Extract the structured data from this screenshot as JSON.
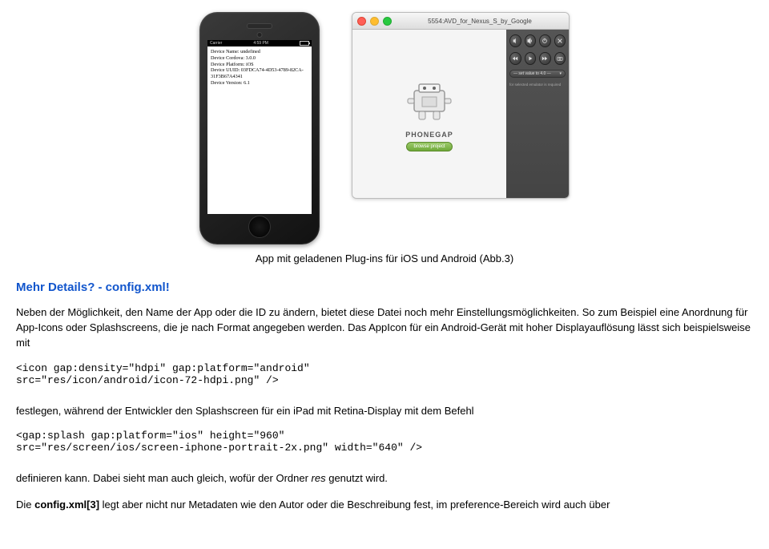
{
  "figures": {
    "phone": {
      "status_carrier": "Carrier",
      "status_signal": "≈",
      "status_time": "4:59 PM",
      "device_lines": [
        "Device Name: undefined",
        "Device Cordova: 3.0.0",
        "Device Platform: iOS",
        "Device UUID: 03FDCA74-4D53-4789-82CA-31F3B67A4341",
        "Device Version: 6.1"
      ]
    },
    "emulator": {
      "window_title": "5554:AVD_for_Nexus_S_by_Google",
      "label": "PHONEGAP",
      "browse_btn": "browse project",
      "side_combo": "— set value to 4.0 —",
      "side_note": "for selected emulator is required"
    }
  },
  "caption": "App mit geladenen Plug-ins für iOS und Android (Abb.3)",
  "heading": "Mehr Details? - config.xml!",
  "para1": "Neben der Möglichkeit, den Name der App oder die ID zu ändern, bietet diese Datei noch mehr Einstellungsmöglichkeiten. So zum Beispiel eine Anordnung für App-Icons oder Splashscreens, die je nach Format angegeben werden. Das AppIcon für ein Android-Gerät mit hoher Displayauflösung lässt sich beispielsweise mit",
  "code1": "<icon gap:density=\"hdpi\" gap:platform=\"android\"\nsrc=\"res/icon/android/icon-72-hdpi.png\" />",
  "para2": "festlegen, während der Entwickler den Splashscreen für ein iPad mit Retina-Display mit dem Befehl",
  "code2": "<gap:splash gap:platform=\"ios\" height=\"960\"\nsrc=\"res/screen/ios/screen-iphone-portrait-2x.png\" width=\"640\" />",
  "para3_pre": "definieren kann. Dabei sieht man auch gleich, wofür der Ordner ",
  "para3_italic": "res",
  "para3_post": " genutzt wird.",
  "para4_pre": "Die ",
  "para4_bold": "config.xml[3]",
  "para4_post": " legt aber nicht nur Metadaten wie den Autor oder die Beschreibung fest, im preference-Bereich wird auch über"
}
